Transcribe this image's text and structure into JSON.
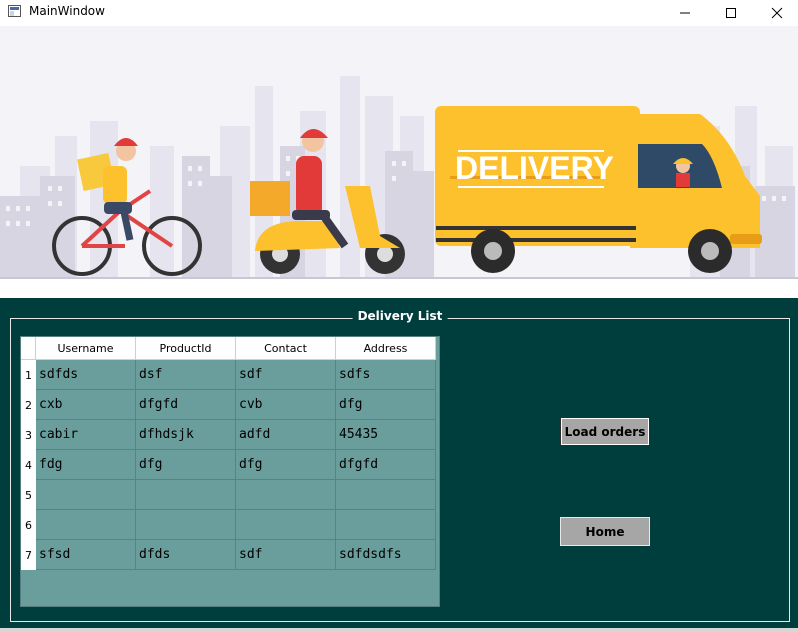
{
  "window": {
    "title": "MainWindow",
    "controls": [
      "minimize-icon",
      "maximize-icon",
      "close-icon"
    ]
  },
  "banner": {
    "van_text": "DELIVERY",
    "colors": {
      "sky": "#f3f2f7",
      "van": "#fcc12d",
      "building": "#d9d7e4",
      "shirt": "#e13a38"
    }
  },
  "group": {
    "title": "Delivery List"
  },
  "table": {
    "columns": [
      "Username",
      "ProductId",
      "Contact",
      "Address"
    ],
    "row_numbers": [
      "1",
      "2",
      "3",
      "4",
      "5",
      "6",
      "7"
    ],
    "rows": [
      [
        "sdfds",
        "dsf",
        "sdf",
        "sdfs"
      ],
      [
        "cxb",
        "dfgfd",
        "cvb",
        "dfg"
      ],
      [
        "cabir",
        "dfhdsjk",
        "adfd",
        "45435"
      ],
      [
        "fdg",
        "dfg",
        "dfg",
        "dfgfd"
      ],
      [
        "",
        "",
        "",
        ""
      ],
      [
        "",
        "",
        "",
        ""
      ],
      [
        "sfsd",
        "dfds",
        "sdf",
        "sdfdsdfs"
      ]
    ]
  },
  "buttons": {
    "load": "Load orders",
    "home": "Home"
  },
  "colors": {
    "panel_bg": "#003d3d",
    "table_bg": "#699e9c",
    "button_bg": "#a6a6a6"
  }
}
